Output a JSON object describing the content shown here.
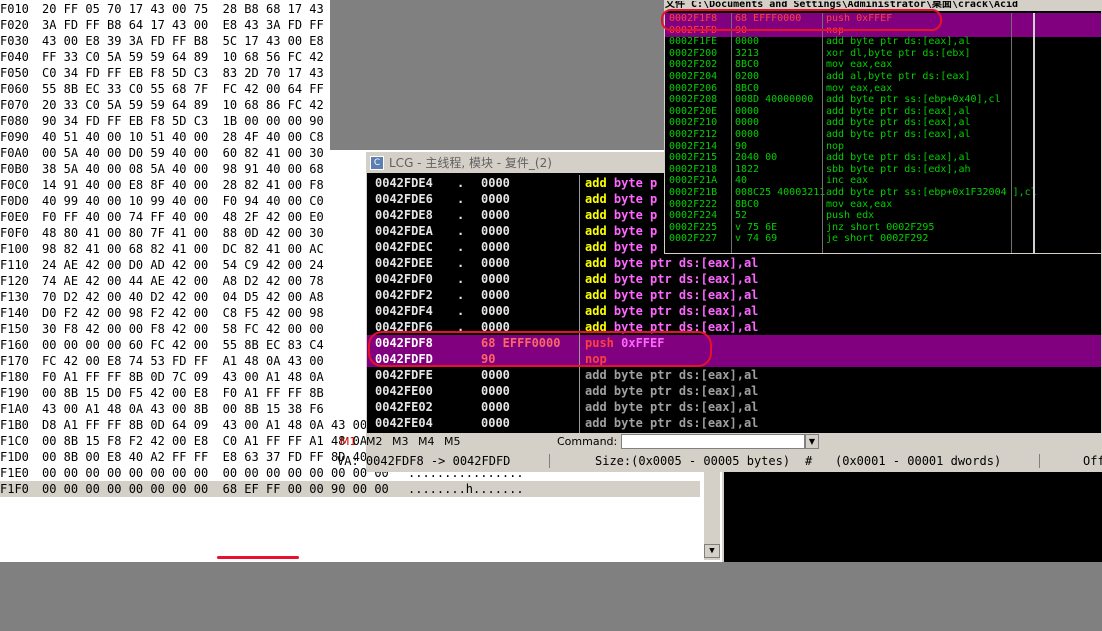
{
  "hex": {
    "rows": [
      {
        "addr": "F010",
        "bytes": "20 FF 05 70 17 43 00 75  28 B8 68 17 43",
        "ascii": ""
      },
      {
        "addr": "F020",
        "bytes": "3A FD FF B8 64 17 43 00  E8 43 3A FD FF",
        "ascii": ""
      },
      {
        "addr": "F030",
        "bytes": "43 00 E8 39 3A FD FF B8  5C 17 43 00 E8",
        "ascii": ""
      },
      {
        "addr": "F040",
        "bytes": "FF 33 C0 5A 59 59 64 89  10 68 56 FC 42",
        "ascii": ""
      },
      {
        "addr": "F050",
        "bytes": "C0 34 FD FF EB F8 5D C3  83 2D 70 17 43",
        "ascii": ""
      },
      {
        "addr": "F060",
        "bytes": "55 8B EC 33 C0 55 68 7F  FC 42 00 64 FF",
        "ascii": ""
      },
      {
        "addr": "F070",
        "bytes": "20 33 C0 5A 59 59 64 89  10 68 86 FC 42",
        "ascii": ""
      },
      {
        "addr": "F080",
        "bytes": "90 34 FD FF EB F8 5D C3  1B 00 00 00 90",
        "ascii": ""
      },
      {
        "addr": "F090",
        "bytes": "40 51 40 00 10 51 40 00  28 4F 40 00 C8",
        "ascii": ""
      },
      {
        "addr": "F0A0",
        "bytes": "00 5A 40 00 D0 59 40 00  60 82 41 00 30",
        "ascii": ""
      },
      {
        "addr": "F0B0",
        "bytes": "38 5A 40 00 08 5A 40 00  98 91 40 00 68",
        "ascii": ""
      },
      {
        "addr": "F0C0",
        "bytes": "14 91 40 00 E8 8F 40 00  28 82 41 00 F8",
        "ascii": ""
      },
      {
        "addr": "F0D0",
        "bytes": "40 99 40 00 10 99 40 00  F0 94 40 00 C0",
        "ascii": ""
      },
      {
        "addr": "F0E0",
        "bytes": "F0 FF 40 00 74 FF 40 00  48 2F 42 00 E0",
        "ascii": ""
      },
      {
        "addr": "F0F0",
        "bytes": "48 80 41 00 80 7F 41 00  88 0D 42 00 30",
        "ascii": ""
      },
      {
        "addr": "F100",
        "bytes": "98 82 41 00 68 82 41 00  DC 82 41 00 AC",
        "ascii": ""
      },
      {
        "addr": "F110",
        "bytes": "24 AE 42 00 D0 AD 42 00  54 C9 42 00 24",
        "ascii": ""
      },
      {
        "addr": "F120",
        "bytes": "74 AE 42 00 44 AE 42 00  A8 D2 42 00 78",
        "ascii": ""
      },
      {
        "addr": "F130",
        "bytes": "70 D2 42 00 40 D2 42 00  04 D5 42 00 A8",
        "ascii": ""
      },
      {
        "addr": "F140",
        "bytes": "D0 F2 42 00 98 F2 42 00  C8 F5 42 00 98",
        "ascii": ""
      },
      {
        "addr": "F150",
        "bytes": "30 F8 42 00 00 F8 42 00  58 FC 42 00 00",
        "ascii": ""
      },
      {
        "addr": "F160",
        "bytes": "00 00 00 00 60 FC 42 00  55 8B EC 83 C4",
        "ascii": ""
      },
      {
        "addr": "F170",
        "bytes": "FC 42 00 E8 74 53 FD FF  A1 48 0A 43 00",
        "ascii": ""
      },
      {
        "addr": "F180",
        "bytes": "F0 A1 FF FF 8B 0D 7C 09  43 00 A1 48 0A",
        "ascii": ""
      },
      {
        "addr": "F190",
        "bytes": "00 8B 15 D0 F5 42 00 E8  F0 A1 FF FF 8B",
        "ascii": ""
      },
      {
        "addr": "F1A0",
        "bytes": "43 00 A1 48 0A 43 00 8B  00 8B 15 38 F6",
        "ascii": ""
      },
      {
        "addr": "F1B0",
        "bytes": "D8 A1 FF FF 8B 0D 64 09  43 00 A1 48 0A 43 00 8B",
        "ascii": "......d.C..H.C.."
      },
      {
        "addr": "F1C0",
        "bytes": "00 8B 15 F8 F2 42 00 E8  C0 A1 FF FF A1 48 0A 43",
        "ascii": ".....B.......H.C"
      },
      {
        "addr": "F1D0",
        "bytes": "00 8B 00 E8 40 A2 FF FF  E8 63 37 FD FF 8D 40 00",
        "ascii": "....@....c7...@."
      },
      {
        "addr": "F1E0",
        "bytes": "00 00 00 00 00 00 00 00  00 00 00 00 00 00 00 00",
        "ascii": "................"
      },
      {
        "addr": "F1F0",
        "bytes": "00 00 00 00 00 00 00 00  68 EF FF 00 00 90 00 00",
        "ascii": "........h......."
      }
    ]
  },
  "lcg": {
    "title": "LCG -  主线程, 模块 - 复件_(2)",
    "icon": "C",
    "rows": [
      {
        "addr": "0042FDE4",
        "mark": ".",
        "hex": "0000",
        "op": "add",
        "rest": " byte p",
        "dim": false,
        "hl": false
      },
      {
        "addr": "0042FDE6",
        "mark": ".",
        "hex": "0000",
        "op": "add",
        "rest": " byte p",
        "dim": false,
        "hl": false
      },
      {
        "addr": "0042FDE8",
        "mark": ".",
        "hex": "0000",
        "op": "add",
        "rest": " byte p",
        "dim": false,
        "hl": false
      },
      {
        "addr": "0042FDEA",
        "mark": ".",
        "hex": "0000",
        "op": "add",
        "rest": " byte p",
        "dim": false,
        "hl": false
      },
      {
        "addr": "0042FDEC",
        "mark": ".",
        "hex": "0000",
        "op": "add",
        "rest": " byte p",
        "dim": false,
        "hl": false
      },
      {
        "addr": "0042FDEE",
        "mark": ".",
        "hex": "0000",
        "op": "add",
        "rest": " byte ptr ds:[eax],al",
        "dim": false,
        "hl": false
      },
      {
        "addr": "0042FDF0",
        "mark": ".",
        "hex": "0000",
        "op": "add",
        "rest": " byte ptr ds:[eax],al",
        "dim": false,
        "hl": false
      },
      {
        "addr": "0042FDF2",
        "mark": ".",
        "hex": "0000",
        "op": "add",
        "rest": " byte ptr ds:[eax],al",
        "dim": false,
        "hl": false
      },
      {
        "addr": "0042FDF4",
        "mark": ".",
        "hex": "0000",
        "op": "add",
        "rest": " byte ptr ds:[eax],al",
        "dim": false,
        "hl": false
      },
      {
        "addr": "0042FDF6",
        "mark": ".",
        "hex": "0000",
        "op": "add",
        "rest": " byte ptr ds:[eax],al",
        "dim": false,
        "hl": false
      },
      {
        "addr": "0042FDF8",
        "mark": "",
        "hex": "68 EFFF0000",
        "op": "push",
        "rest": " 0xFFEF",
        "dim": false,
        "hl": true
      },
      {
        "addr": "0042FDFD",
        "mark": "",
        "hex": "90",
        "op": "nop",
        "rest": "",
        "dim": false,
        "hl": true
      },
      {
        "addr": "0042FDFE",
        "mark": "",
        "hex": "0000",
        "op": "add",
        "rest": " byte ptr ds:[eax],al",
        "dim": true,
        "hl": false
      },
      {
        "addr": "0042FE00",
        "mark": "",
        "hex": "0000",
        "op": "add",
        "rest": " byte ptr ds:[eax],al",
        "dim": true,
        "hl": false
      },
      {
        "addr": "0042FE02",
        "mark": "",
        "hex": "0000",
        "op": "add",
        "rest": " byte ptr ds:[eax],al",
        "dim": true,
        "hl": false
      },
      {
        "addr": "0042FE04",
        "mark": "",
        "hex": "0000",
        "op": "add",
        "rest": " byte ptr ds:[eax],al",
        "dim": true,
        "hl": false
      }
    ],
    "tabs": [
      "M1",
      "M2",
      "M3",
      "M4",
      "M5"
    ],
    "command_label": "Command:",
    "command_value": "",
    "status": {
      "va": "VA: 0042FDF8 -> 0042FDFD",
      "size": "Size:(0x0005 - 00005 bytes)",
      "hash": "#",
      "dwords": "(0x0001 - 00001 dwords)",
      "off": "Off"
    }
  },
  "tr": {
    "title": "文件 C:\\Documents and Settings\\Administrator\\桌面\\crack\\Acid",
    "rows": [
      {
        "addr": "0002F1F8",
        "hex": "68 EFFF0000",
        "asm": "push 0xFFEF",
        "hl": true
      },
      {
        "addr": "0002F1FD",
        "hex": "90",
        "asm": "nop",
        "hl": true
      },
      {
        "addr": "0002F1FE",
        "hex": "0000",
        "asm": "add byte ptr ds:[eax],al",
        "hl": false
      },
      {
        "addr": "0002F200",
        "hex": "3213",
        "asm": "xor dl,byte ptr ds:[ebx]",
        "hl": false
      },
      {
        "addr": "0002F202",
        "hex": "8BC0",
        "asm": "mov eax,eax",
        "hl": false
      },
      {
        "addr": "0002F204",
        "hex": "0200",
        "asm": "add al,byte ptr ds:[eax]",
        "hl": false
      },
      {
        "addr": "0002F206",
        "hex": "8BC0",
        "asm": "mov eax,eax",
        "hl": false
      },
      {
        "addr": "0002F208",
        "hex": "008D 40000000",
        "asm": "add byte ptr ss:[ebp+0x40],cl",
        "hl": false
      },
      {
        "addr": "0002F20E",
        "hex": "0000",
        "asm": "add byte ptr ds:[eax],al",
        "hl": false
      },
      {
        "addr": "0002F210",
        "hex": "0000",
        "asm": "add byte ptr ds:[eax],al",
        "hl": false
      },
      {
        "addr": "0002F212",
        "hex": "0000",
        "asm": "add byte ptr ds:[eax],al",
        "hl": false
      },
      {
        "addr": "0002F214",
        "hex": "90",
        "asm": "nop",
        "hl": false
      },
      {
        "addr": "0002F215",
        "hex": "2040 00",
        "asm": "add byte ptr ds:[eax],al",
        "hl": false
      },
      {
        "addr": "0002F218",
        "hex": "1822",
        "asm": "sbb byte ptr ds:[edx],ah",
        "hl": false
      },
      {
        "addr": "0002F21A",
        "hex": "40",
        "asm": "inc eax",
        "hl": false
      },
      {
        "addr": "0002F21B",
        "hex": "008C25 40003211",
        "asm": "add byte ptr ss:[ebp+0x1F32004 ],cl",
        "hl": false
      },
      {
        "addr": "0002F222",
        "hex": "8BC0",
        "asm": "mov eax,eax",
        "hl": false
      },
      {
        "addr": "0002F224",
        "hex": "52",
        "asm": "push edx",
        "hl": false
      },
      {
        "addr": "0002F225",
        "hex": "v 75 6E",
        "asm": "jnz short 0002F295",
        "hl": false
      },
      {
        "addr": "0002F227",
        "hex": "v 74 69",
        "asm": "je short 0002F292",
        "hl": false
      }
    ]
  }
}
